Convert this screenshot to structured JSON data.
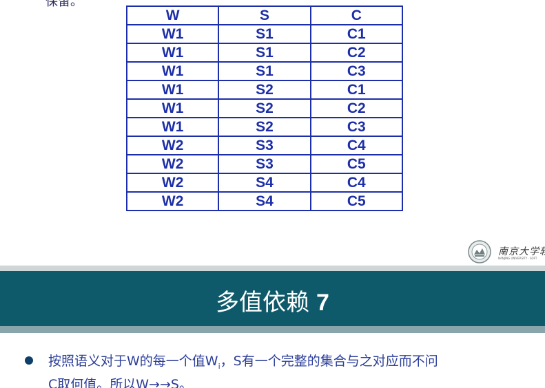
{
  "top_fragment": "保留。",
  "table": {
    "headers": [
      "W",
      "S",
      "C"
    ],
    "rows": [
      [
        "W1",
        "S1",
        "C1"
      ],
      [
        "W1",
        "S1",
        "C2"
      ],
      [
        "W1",
        "S1",
        "C3"
      ],
      [
        "W1",
        "S2",
        "C1"
      ],
      [
        "W1",
        "S2",
        "C2"
      ],
      [
        "W1",
        "S2",
        "C3"
      ],
      [
        "W2",
        "S3",
        "C4"
      ],
      [
        "W2",
        "S3",
        "C5"
      ],
      [
        "W2",
        "S4",
        "C4"
      ],
      [
        "W2",
        "S4",
        "C5"
      ]
    ]
  },
  "logo": {
    "text": "南京大学软",
    "subtext": "NANJING UNIVERSITY · SOFT",
    "icon": "university-seal-icon"
  },
  "title": {
    "main": "多值依赖",
    "number": "7"
  },
  "bullet": {
    "line1_before": "按照语义对于W的每一个值W",
    "line1_sub": "i",
    "line1_after": "，S有一个完整的集合与之对应而不问",
    "line2": "C取何值。所以W→→S。"
  },
  "colors": {
    "table_text": "#1c2fa8",
    "title_band": "#0e5a6a",
    "bullet_text": "#2b3e9a"
  }
}
